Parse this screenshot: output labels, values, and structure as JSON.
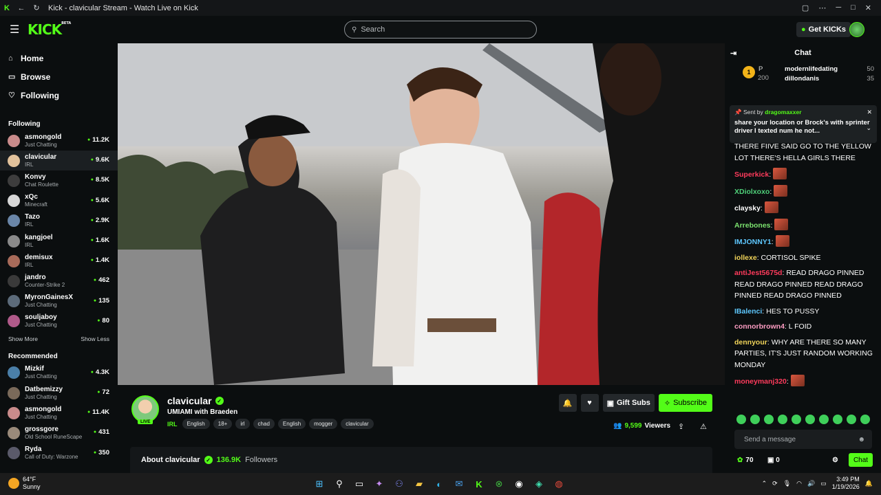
{
  "window": {
    "title": "Kick - clavicular Stream - Watch Live on Kick"
  },
  "search": {
    "placeholder": "Search"
  },
  "header": {
    "get_kicks": "Get KICKs"
  },
  "logo": {
    "text": "KICK",
    "beta": "BETA"
  },
  "nav": {
    "home": "Home",
    "browse": "Browse",
    "following": "Following"
  },
  "following": {
    "title": "Following",
    "channels": [
      {
        "name": "asmongold",
        "category": "Just Chatting",
        "viewers": "11.2K",
        "color": "#c98b8b"
      },
      {
        "name": "clavicular",
        "category": "IRL",
        "viewers": "9.6K",
        "color": "#e2c29c"
      },
      {
        "name": "Konvy",
        "category": "Chat Roulette",
        "viewers": "8.5K",
        "color": "#3d3d3d"
      },
      {
        "name": "xQc",
        "category": "Minecraft",
        "viewers": "5.6K",
        "color": "#d7d7d7"
      },
      {
        "name": "Tazo",
        "category": "IRL",
        "viewers": "2.9K",
        "color": "#6a86a8"
      },
      {
        "name": "kangjoel",
        "category": "IRL",
        "viewers": "1.6K",
        "color": "#8a8a8a"
      },
      {
        "name": "demisux",
        "category": "IRL",
        "viewers": "1.4K",
        "color": "#a86b5a"
      },
      {
        "name": "jandro",
        "category": "Counter-Strike 2",
        "viewers": "462",
        "color": "#3a3a3a"
      },
      {
        "name": "MyronGainesX",
        "category": "Just Chatting",
        "viewers": "135",
        "color": "#5c6b7a"
      },
      {
        "name": "souljaboy",
        "category": "Just Chatting",
        "viewers": "80",
        "color": "#b05a8a"
      }
    ],
    "show_more": "Show More",
    "show_less": "Show Less"
  },
  "recommended": {
    "title": "Recommended",
    "channels": [
      {
        "name": "Mizkif",
        "category": "Just Chatting",
        "viewers": "4.3K",
        "color": "#4a7fa8"
      },
      {
        "name": "Datbemizzy",
        "category": "Just Chatting",
        "viewers": "72",
        "color": "#7a6a5a"
      },
      {
        "name": "asmongold",
        "category": "Just Chatting",
        "viewers": "11.4K",
        "color": "#c98b8b"
      },
      {
        "name": "grossgore",
        "category": "Old School RuneScape",
        "viewers": "431",
        "color": "#9a8a7a"
      },
      {
        "name": "Ryda",
        "category": "Call of Duty: Warzone",
        "viewers": "350",
        "color": "#5a5a6a"
      }
    ]
  },
  "stream": {
    "channel": "clavicular",
    "live": "LIVE",
    "title": "UMIAMI with Braeden",
    "category": "IRL",
    "tags": [
      "English",
      "18+",
      "irl",
      "chad",
      "English",
      "mogger",
      "clavicular"
    ],
    "gift_subs": "Gift Subs",
    "subscribe": "Subscribe",
    "viewers": "9,599",
    "viewers_label": "Viewers",
    "about_label": "About clavicular",
    "followers": "136.9K",
    "followers_label": "Followers"
  },
  "chat": {
    "title": "Chat",
    "leaderboard": {
      "rank_label": "P",
      "points": "200",
      "rows": [
        {
          "name": "modernlifedating",
          "count": "50"
        },
        {
          "name": "dillondanis",
          "count": "35"
        }
      ]
    },
    "pinned": {
      "sent_by": "Sent by",
      "user": "dragomaxxer",
      "text": "share your location or Brock's with sprinter driver I texted num he not..."
    },
    "messages": [
      {
        "user": "",
        "text": "THERE FIIVE SAID GO TO THE YELLOW LOT THERE'S HELLA GIRLS THERE",
        "color": "#ffffff"
      },
      {
        "user": "Superkick",
        "text": "",
        "color": "#ff3b5c"
      },
      {
        "user": "XDiolxoxo",
        "text": "",
        "color": "#4fd17a"
      },
      {
        "user": "claysky",
        "text": "",
        "color": "#ffffff"
      },
      {
        "user": "Arrebones",
        "text": "",
        "color": "#7ce36f"
      },
      {
        "user": "IMJONNY1",
        "text": "",
        "color": "#5ec8ff"
      },
      {
        "user": "iollexe",
        "text": "CORTISOL SPIKE",
        "color": "#f2d55a"
      },
      {
        "user": "antiJest5675d",
        "text": "READ DRAGO PINNED READ DRAGO PINNED READ DRAGO PINNED READ DRAGO PINNED",
        "color": "#ff3b5c"
      },
      {
        "user": "IBalenci",
        "text": "HES TO PUSSY",
        "color": "#5ec8ff"
      },
      {
        "user": "connorbrown4",
        "text": "L FOID",
        "color": "#ff9ec4"
      },
      {
        "user": "dennyour",
        "text": "WHY ARE THERE SO MANY PARTIES, IT'S JUST RANDOM WORKING MONDAY",
        "color": "#f2d55a"
      },
      {
        "user": "moneymanj320",
        "text": "",
        "color": "#ff3b5c"
      }
    ],
    "input_placeholder": "Send a message",
    "points": "70",
    "gifts": "0",
    "send": "Chat"
  },
  "taskbar": {
    "temp": "64°F",
    "weather": "Sunny",
    "time": "3:49 PM",
    "date": "1/19/2026"
  }
}
